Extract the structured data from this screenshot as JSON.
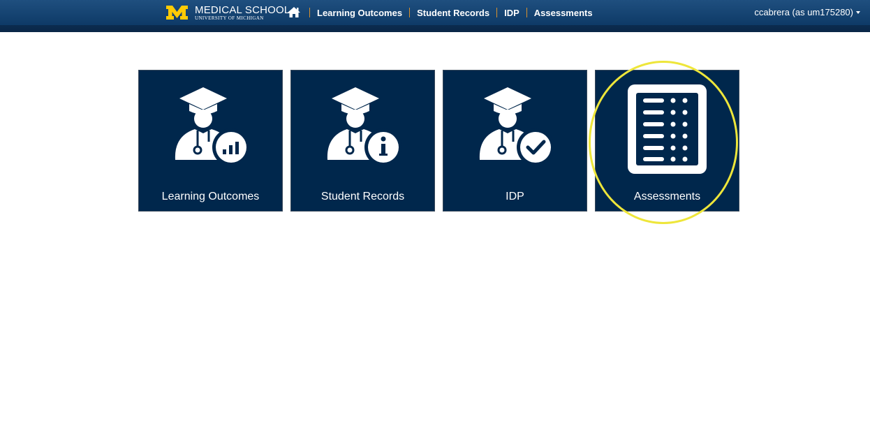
{
  "header": {
    "brand_title": "MEDICAL SCHOOL",
    "brand_subtitle": "UNIVERSITY OF MICHIGAN",
    "brand_color": "#ffcb05",
    "home_icon": "home-icon",
    "nav": [
      {
        "label": "Learning Outcomes"
      },
      {
        "label": "Student Records"
      },
      {
        "label": "IDP"
      },
      {
        "label": "Assessments"
      }
    ],
    "user_label": "ccabrera (as um175280)"
  },
  "tiles": [
    {
      "label": "Learning Outcomes",
      "icon": "student-chart-icon"
    },
    {
      "label": "Student Records",
      "icon": "student-info-icon"
    },
    {
      "label": "IDP",
      "icon": "student-check-icon"
    },
    {
      "label": "Assessments",
      "icon": "assessment-list-icon"
    }
  ],
  "colors": {
    "tile_bg": "#00274c",
    "nav_separator": "#d9922e",
    "highlight": "#eee63a"
  }
}
